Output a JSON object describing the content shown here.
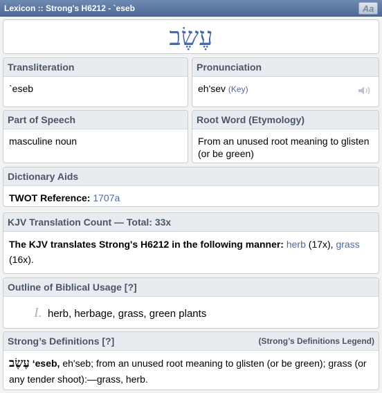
{
  "window": {
    "title": "Lexicon :: Strong's H6212 - `eseb",
    "font_button": "Aa"
  },
  "headword": {
    "hebrew": "עֶשֶׂב"
  },
  "transliteration": {
    "header": "Transliteration",
    "value": "`eseb"
  },
  "pronunciation": {
    "header": "Pronunciation",
    "value": "eh'sev",
    "key_link": "(Key)",
    "icon": "speaker-icon"
  },
  "part_of_speech": {
    "header": "Part of Speech",
    "value": "masculine noun"
  },
  "root_word": {
    "header": "Root Word (Etymology)",
    "value": "From an unused root meaning to glisten (or be green)"
  },
  "dictionary_aids": {
    "header": "Dictionary Aids",
    "label": "TWOT Reference:",
    "value": "1707a"
  },
  "kjv_count": {
    "header": "KJV Translation Count — Total: 33x",
    "lead": "The KJV translates Strong's H6212 in the following manner:",
    "items": [
      {
        "word": "herb",
        "count": "(17x),"
      },
      {
        "word": "grass",
        "count": "(16x)."
      }
    ]
  },
  "outline": {
    "header": "Outline of Biblical Usage [?]",
    "items": [
      {
        "numeral": "I.",
        "text": "herb, herbage, grass, green plants"
      }
    ]
  },
  "strongs_defs": {
    "header": "Strong’s Definitions [?]",
    "legend_link": "(Strong’s Definitions Legend)",
    "hebrew": "עֶשֶׂב",
    "translit": "ʻeseb,",
    "text": "eh'seb; from an unused root meaning to glisten (or be green); grass (or any tender shoot):—grass, herb."
  },
  "colors": {
    "accent": "#4a68a8",
    "header_bg": "#e8ecf1",
    "titlebar": "#5b76a3"
  }
}
